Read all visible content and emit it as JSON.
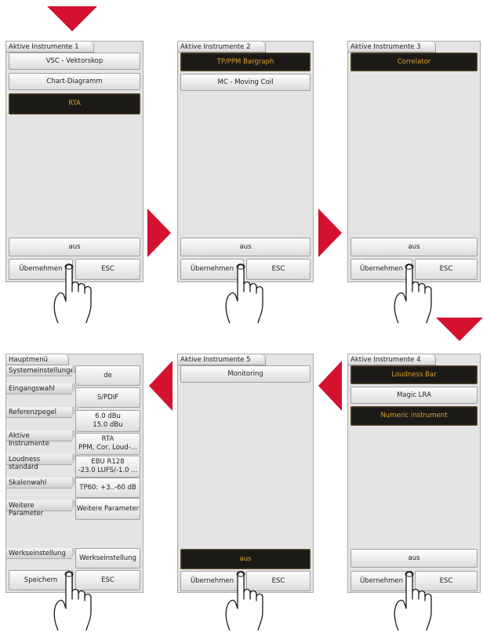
{
  "panels": {
    "p1": {
      "title": "Aktive Instrumente 1",
      "items": [
        "VSC - Vektorskop",
        "Chart-Diagramm",
        "RTA"
      ],
      "off": "aus",
      "accept": "Übernehmen",
      "esc": "ESC"
    },
    "p2": {
      "title": "Aktive Instrumente 2",
      "items": [
        "TP/PPM Bargraph",
        "MC - Moving Coil"
      ],
      "off": "aus",
      "accept": "Übernehmen",
      "esc": "ESC"
    },
    "p3": {
      "title": "Aktive Instrumente 3",
      "items": [
        "Correlator"
      ],
      "off": "aus",
      "accept": "Übernehmen",
      "esc": "ESC"
    },
    "p4": {
      "title": "Aktive Instrumente 4",
      "items": [
        "Loudness Bar",
        "Magic LRA",
        "Numeric instrument"
      ],
      "off": "aus",
      "accept": "Übernehmen",
      "esc": "ESC"
    },
    "p5": {
      "title": "Aktive Instrumente 5",
      "items": [
        "Monitoring"
      ],
      "off": "aus",
      "accept": "Übernehmen",
      "esc": "ESC"
    }
  },
  "menu": {
    "title": "Hauptmenü",
    "rows": [
      {
        "label": "Systemeinstellungen",
        "value": "de"
      },
      {
        "label": "Eingangswahl",
        "value": "S/PDIF"
      },
      {
        "label": "Referenzpegel",
        "value": "6.0 dBu\n15.0 dBu"
      },
      {
        "label": "Aktive Instrumente",
        "value": "RTA\nPPM, Cor, Loud-..."
      },
      {
        "label": "Loudness standard",
        "value": "EBU R128\n-23.0 LUFS/-1.0 ..."
      },
      {
        "label": "Skalenwahl",
        "value": "TP60: +3..-60 dB"
      },
      {
        "label": "Weitere Parameter",
        "value": "Weitere Parameter"
      },
      {
        "label": "Werkseinstellung",
        "value": "Werkseinstellung"
      }
    ],
    "save": "Speichern",
    "esc": "ESC"
  },
  "colors": {
    "arrow": "#d4112f",
    "selected_text": "#d8a030",
    "selected_bg": "#1c1a17",
    "panel_bg": "#e4e4e4"
  }
}
